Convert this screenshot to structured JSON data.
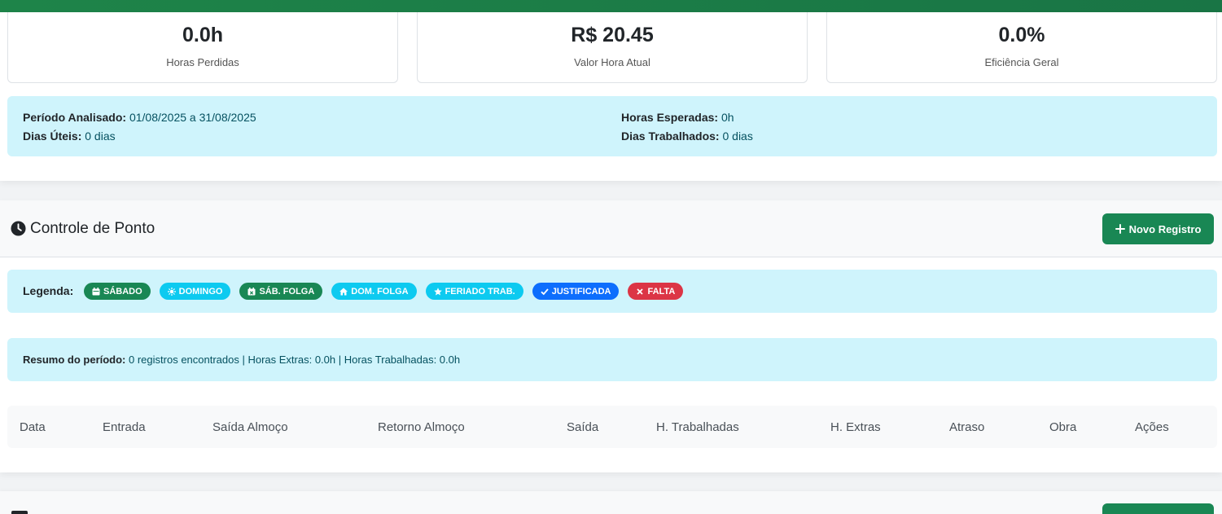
{
  "stats": [
    {
      "value": "0.0h",
      "label": "Horas Perdidas"
    },
    {
      "value": "R$ 20.45",
      "label": "Valor Hora Atual"
    },
    {
      "value": "0.0%",
      "label": "Eficiência Geral"
    }
  ],
  "period_info": {
    "periodo_label": "Período Analisado:",
    "periodo_value": "01/08/2025 a 31/08/2025",
    "dias_uteis_label": "Dias Úteis:",
    "dias_uteis_value": "0 dias",
    "horas_esperadas_label": "Horas Esperadas:",
    "horas_esperadas_value": "0h",
    "dias_trabalhados_label": "Dias Trabalhados:",
    "dias_trabalhados_value": "0 dias"
  },
  "ponto": {
    "title": "Controle de Ponto",
    "new_button": "Novo Registro",
    "legend_label": "Legenda:",
    "badges": [
      {
        "label": "SÁBADO",
        "icon": "calendar-icon",
        "color": "#198754"
      },
      {
        "label": "DOMINGO",
        "icon": "sun-icon",
        "color": "#0dcaf0"
      },
      {
        "label": "SÁB. FOLGA",
        "icon": "calendar-x-icon",
        "color": "#198754"
      },
      {
        "label": "DOM. FOLGA",
        "icon": "home-icon",
        "color": "#0dcaf0"
      },
      {
        "label": "FERIADO TRAB.",
        "icon": "star-icon",
        "color": "#0dcaf0"
      },
      {
        "label": "JUSTIFICADA",
        "icon": "check-icon",
        "color": "#0d6efd"
      },
      {
        "label": "FALTA",
        "icon": "x-icon",
        "color": "#dc3545"
      }
    ],
    "resumo_label": "Resumo do período:",
    "resumo_text": "0 registros encontrados | Horas Extras: 0.0h | Horas Trabalhadas: 0.0h",
    "columns": [
      "Data",
      "Entrada",
      "Saída Almoço",
      "Retorno Almoço",
      "Saída",
      "H. Trabalhadas",
      "H. Extras",
      "Atraso",
      "Obra",
      "Ações"
    ]
  },
  "colors": {
    "brand_green": "#198754",
    "info_bg": "#cff4fc",
    "info_text": "#055160"
  }
}
